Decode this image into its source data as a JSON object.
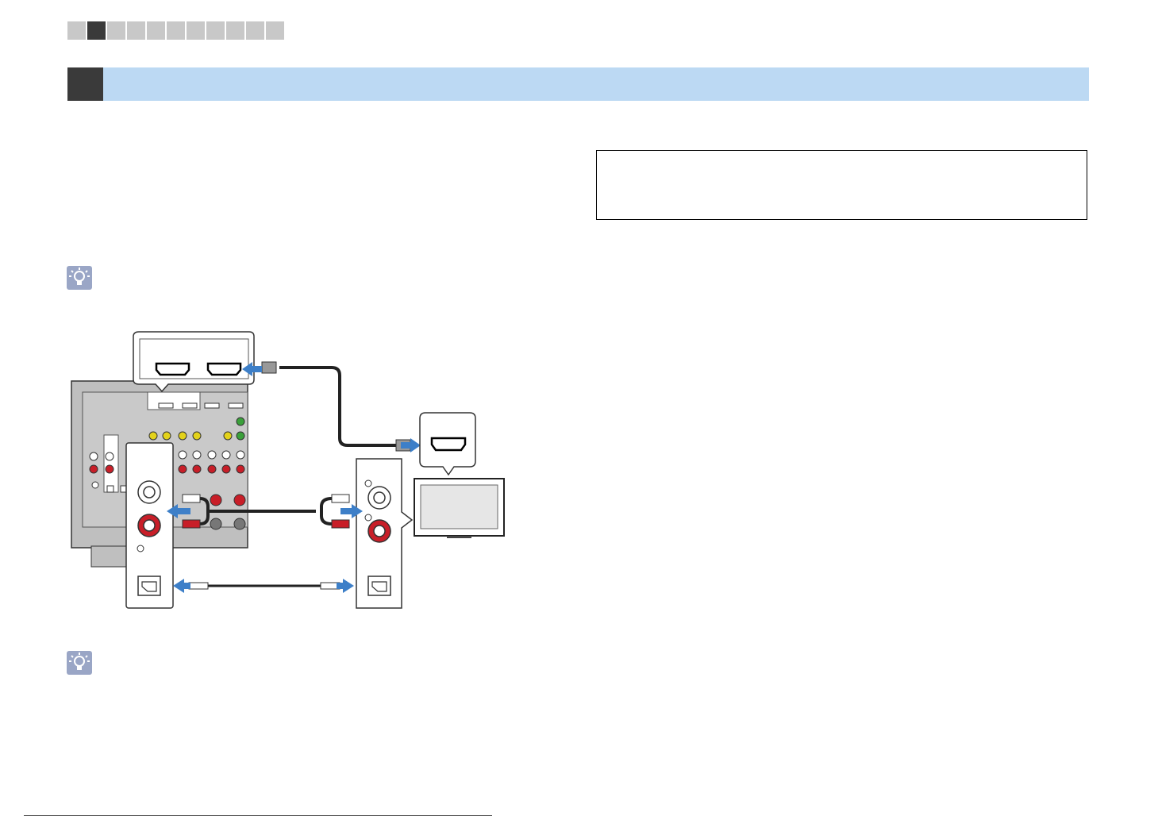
{
  "nav": {
    "steps": [
      {
        "id": "step-1",
        "active": false
      },
      {
        "id": "step-2",
        "active": true
      },
      {
        "id": "step-3",
        "active": false
      },
      {
        "id": "step-4",
        "active": false
      },
      {
        "id": "step-5",
        "active": false
      },
      {
        "id": "step-6",
        "active": false
      },
      {
        "id": "step-7",
        "active": false
      },
      {
        "id": "step-8",
        "active": false
      },
      {
        "id": "step-9",
        "active": false
      },
      {
        "id": "step-10",
        "active": false
      },
      {
        "id": "step-11",
        "active": false
      }
    ]
  },
  "section": {
    "number": "",
    "title": ""
  },
  "note_box": {
    "text": ""
  },
  "footer": {
    "text": ""
  },
  "colors": {
    "header_bar": "#bcd9f3",
    "dark": "#3a3a3a",
    "step_inactive": "#c8c8c8",
    "hint_icon": "#9aa6c6",
    "arrow_blue": "#3d7fc8",
    "plug_red": "#c81e28",
    "panel_gray": "#bfbfbf"
  },
  "icons": {
    "hint": "lightbulb-icon",
    "hdmi": "hdmi-port-icon",
    "optical": "optical-port-icon",
    "rca": "rca-jack-icon",
    "tv": "tv-icon"
  }
}
